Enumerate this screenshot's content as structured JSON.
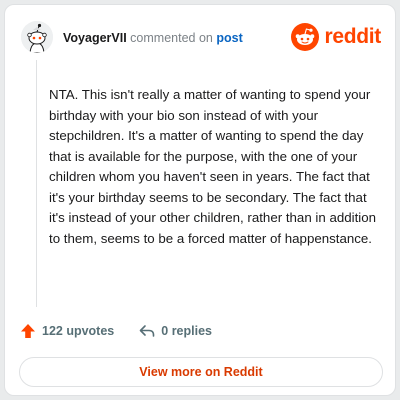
{
  "colors": {
    "brand": "#ff4500",
    "link": "#0a65c2",
    "text": "#1a1a1b",
    "muted": "#576f76",
    "view_more_text": "#d93a00"
  },
  "header": {
    "author": "VoyagerVII",
    "action_text": "commented on",
    "post_link": "post",
    "brand_name": "reddit",
    "avatar_icon": "snoo-avatar-icon",
    "logo_icon": "reddit-snoo-icon"
  },
  "comment": {
    "text": "NTA. This isn't really a matter of wanting to spend your birthday with your bio son instead of with your stepchildren. It's a matter of wanting to spend the day that is available for the purpose, with the one of your children whom you haven't seen in years. The fact that it's your birthday seems to be secondary. The fact that it's instead of your other children, rather than in addition to them, seems to be a forced matter of happenstance."
  },
  "actions": {
    "upvotes_label": "122 upvotes",
    "upvote_icon": "upvote-arrow-icon",
    "replies_label": "0 replies",
    "reply_icon": "reply-arrow-icon"
  },
  "footer": {
    "view_more_label": "View more on Reddit"
  }
}
